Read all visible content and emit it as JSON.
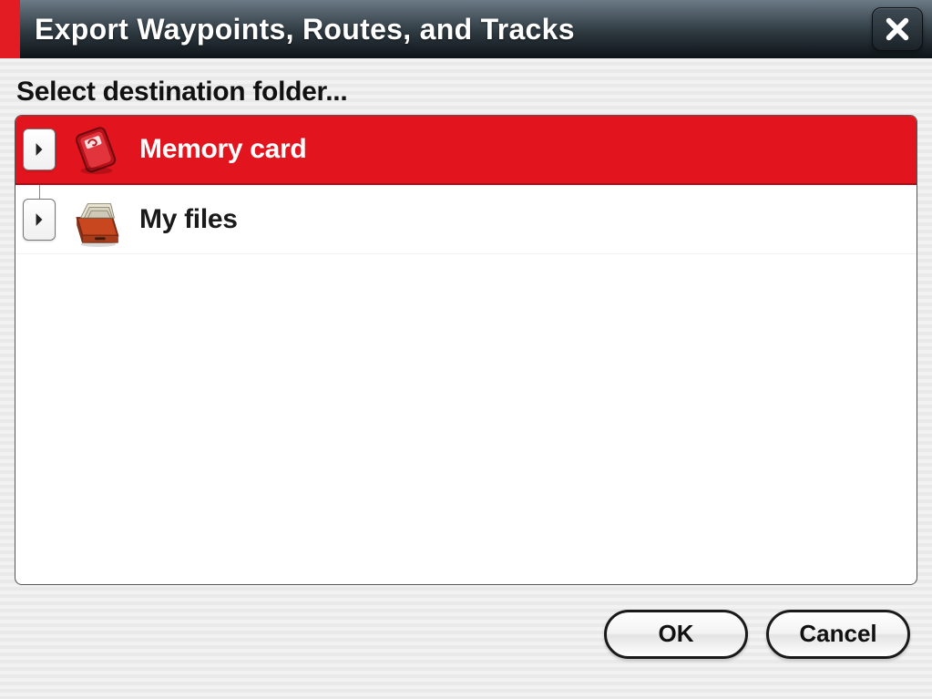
{
  "titlebar": {
    "title": "Export Waypoints, Routes, and Tracks"
  },
  "subheading": "Select destination folder...",
  "folders": [
    {
      "label": "Memory card",
      "icon": "memory-card",
      "selected": true
    },
    {
      "label": "My files",
      "icon": "file-drawer",
      "selected": false
    }
  ],
  "buttons": {
    "ok": "OK",
    "cancel": "Cancel"
  },
  "colors": {
    "accent": "#e2141e",
    "titlebar_top": "#6b7a86",
    "titlebar_bottom": "#0d1418"
  }
}
